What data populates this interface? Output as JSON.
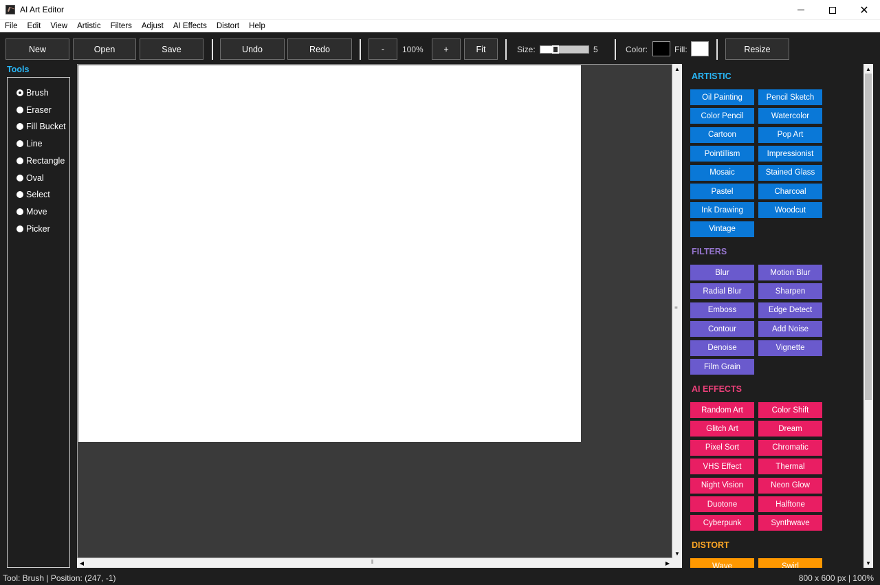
{
  "window": {
    "title": "AI Art Editor"
  },
  "menu": [
    "File",
    "Edit",
    "View",
    "Artistic",
    "Filters",
    "Adjust",
    "AI Effects",
    "Distort",
    "Help"
  ],
  "toolbar": {
    "new": "New",
    "open": "Open",
    "save": "Save",
    "undo": "Undo",
    "redo": "Redo",
    "zoom_out": "-",
    "zoom_level": "100%",
    "zoom_in": "+",
    "fit": "Fit",
    "size_label": "Size:",
    "size_value": "5",
    "size_fraction": 0.1,
    "color_label": "Color:",
    "fill_label": "Fill:",
    "color_value": "#000000",
    "fill_value": "#ffffff",
    "resize": "Resize"
  },
  "tools": {
    "title": "Tools",
    "items": [
      "Brush",
      "Eraser",
      "Fill Bucket",
      "Line",
      "Rectangle",
      "Oval",
      "Select",
      "Move",
      "Picker"
    ],
    "selected": "Brush"
  },
  "sections": {
    "artistic": {
      "title": "ARTISTIC",
      "color": "#0a78d7",
      "title_color": "#29b6f6",
      "buttons": [
        "Oil Painting",
        "Pencil Sketch",
        "Color Pencil",
        "Watercolor",
        "Cartoon",
        "Pop Art",
        "Pointillism",
        "Impressionist",
        "Mosaic",
        "Stained Glass",
        "Pastel",
        "Charcoal",
        "Ink Drawing",
        "Woodcut",
        "Vintage"
      ]
    },
    "filters": {
      "title": "FILTERS",
      "color": "#6a5acd",
      "title_color": "#9575cd",
      "buttons": [
        "Blur",
        "Motion Blur",
        "Radial Blur",
        "Sharpen",
        "Emboss",
        "Edge Detect",
        "Contour",
        "Add Noise",
        "Denoise",
        "Vignette",
        "Film Grain"
      ]
    },
    "ai_effects": {
      "title": "AI EFFECTS",
      "color": "#e91e63",
      "title_color": "#ec407a",
      "buttons": [
        "Random Art",
        "Color Shift",
        "Glitch Art",
        "Dream",
        "Pixel Sort",
        "Chromatic",
        "VHS Effect",
        "Thermal",
        "Night Vision",
        "Neon Glow",
        "Duotone",
        "Halftone",
        "Cyberpunk",
        "Synthwave"
      ]
    },
    "distort": {
      "title": "DISTORT",
      "color": "#ff9800",
      "title_color": "#ffa726",
      "buttons": [
        "Wave",
        "Swirl"
      ]
    }
  },
  "status": {
    "left": "Tool: Brush | Position: (247, -1)",
    "right": "800 x 600 px | 100%"
  }
}
